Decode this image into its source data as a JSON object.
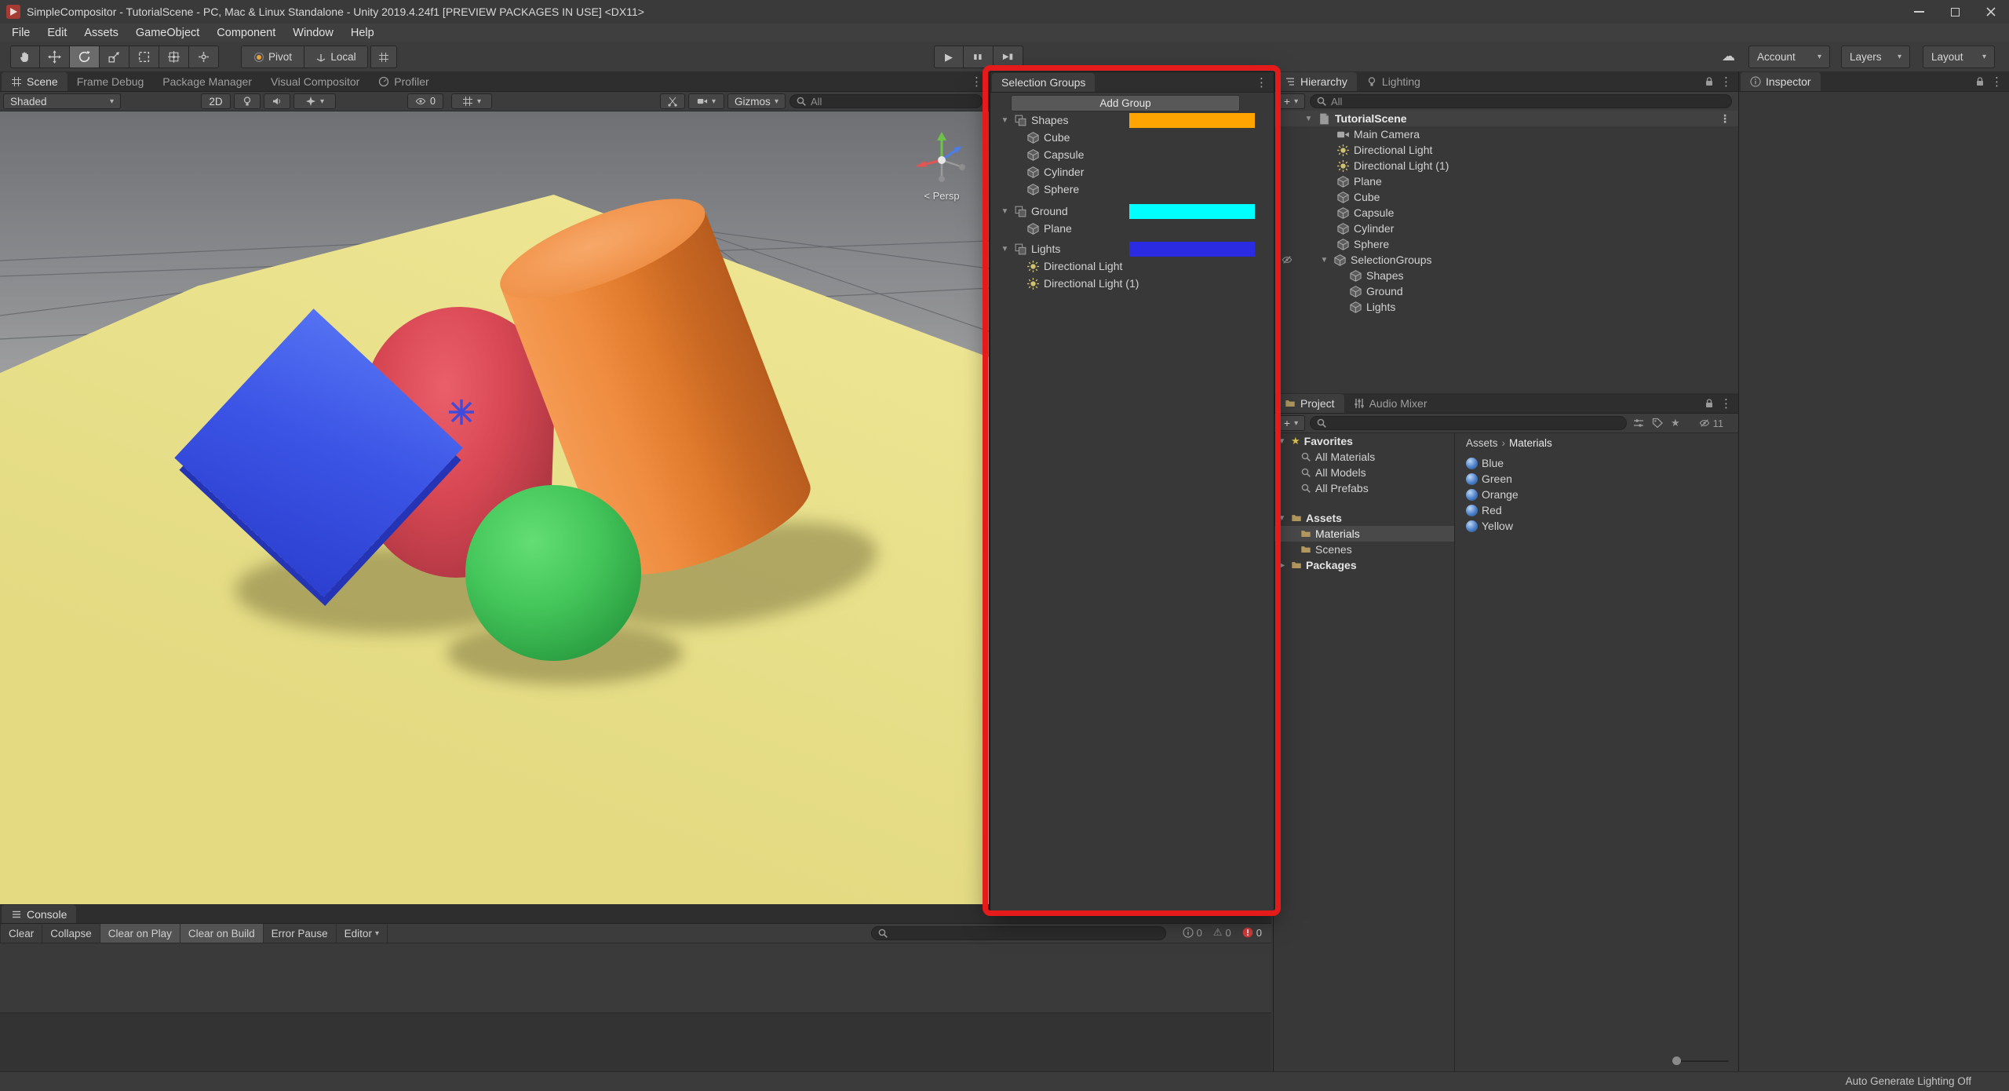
{
  "icons": {
    "caret": "▾",
    "fold_open": "▼",
    "fold_closed": "▶",
    "kebab": "⋮",
    "star": "★",
    "cloud": "☁",
    "warning": "⚠",
    "play": "▶",
    "pause": "▮▮",
    "step": "▶▮",
    "breadcrumb_sep": "›",
    "plus": "+"
  },
  "window": {
    "title": "SimpleCompositor - TutorialScene - PC, Mac & Linux Standalone - Unity 2019.4.24f1 [PREVIEW PACKAGES IN USE] <DX11>",
    "status_right": "Auto Generate Lighting Off"
  },
  "menubar": {
    "items": [
      "File",
      "Edit",
      "Assets",
      "GameObject",
      "Component",
      "Window",
      "Help"
    ]
  },
  "toolbar": {
    "pivot": "Pivot",
    "local": "Local",
    "account": "Account",
    "layers": "Layers",
    "layout": "Layout"
  },
  "scene_panel": {
    "tabs": [
      "Scene",
      "Frame Debug",
      "Package Manager",
      "Visual Compositor",
      "Profiler"
    ],
    "shaded": "Shaded",
    "two_d": "2D",
    "hidden_count": "0",
    "gizmos": "Gizmos",
    "search_text": "All"
  },
  "viewport": {
    "persp_label": "< Persp"
  },
  "selection_groups": {
    "tab": "Selection Groups",
    "add_button": "Add Group",
    "groups": [
      {
        "name": "Shapes",
        "color": "#ffa400",
        "members": [
          "Cube",
          "Capsule",
          "Cylinder",
          "Sphere"
        ]
      },
      {
        "name": "Ground",
        "color": "#00ffff",
        "members": [
          "Plane"
        ]
      },
      {
        "name": "Lights",
        "color": "#2b2be4",
        "members": [
          "Directional Light",
          "Directional Light (1)"
        ]
      }
    ]
  },
  "hierarchy": {
    "tab": "Hierarchy",
    "tab_lighting": "Lighting",
    "search_text": "All",
    "scene_name": "TutorialScene",
    "items": [
      "Main Camera",
      "Directional Light",
      "Directional Light (1)",
      "Plane",
      "Cube",
      "Capsule",
      "Cylinder",
      "Sphere"
    ],
    "group_name": "SelectionGroups",
    "group_children": [
      "Shapes",
      "Ground",
      "Lights"
    ]
  },
  "inspector": {
    "tab": "Inspector"
  },
  "project": {
    "tab": "Project",
    "tab_audio": "Audio Mixer",
    "favorites_label": "Favorites",
    "favorites": [
      "All Materials",
      "All Models",
      "All Prefabs"
    ],
    "assets_label": "Assets",
    "folders": [
      "Materials",
      "Scenes"
    ],
    "packages_label": "Packages",
    "breadcrumb": [
      "Assets",
      "Materials"
    ],
    "materials": [
      "Blue",
      "Green",
      "Orange",
      "Red",
      "Yellow"
    ],
    "hidden_count": "11"
  },
  "console": {
    "tab": "Console",
    "buttons": [
      "Clear",
      "Collapse",
      "Clear on Play",
      "Clear on Build",
      "Error Pause",
      "Editor"
    ],
    "info_count": "0",
    "warning_count": "0",
    "error_count": "0"
  }
}
